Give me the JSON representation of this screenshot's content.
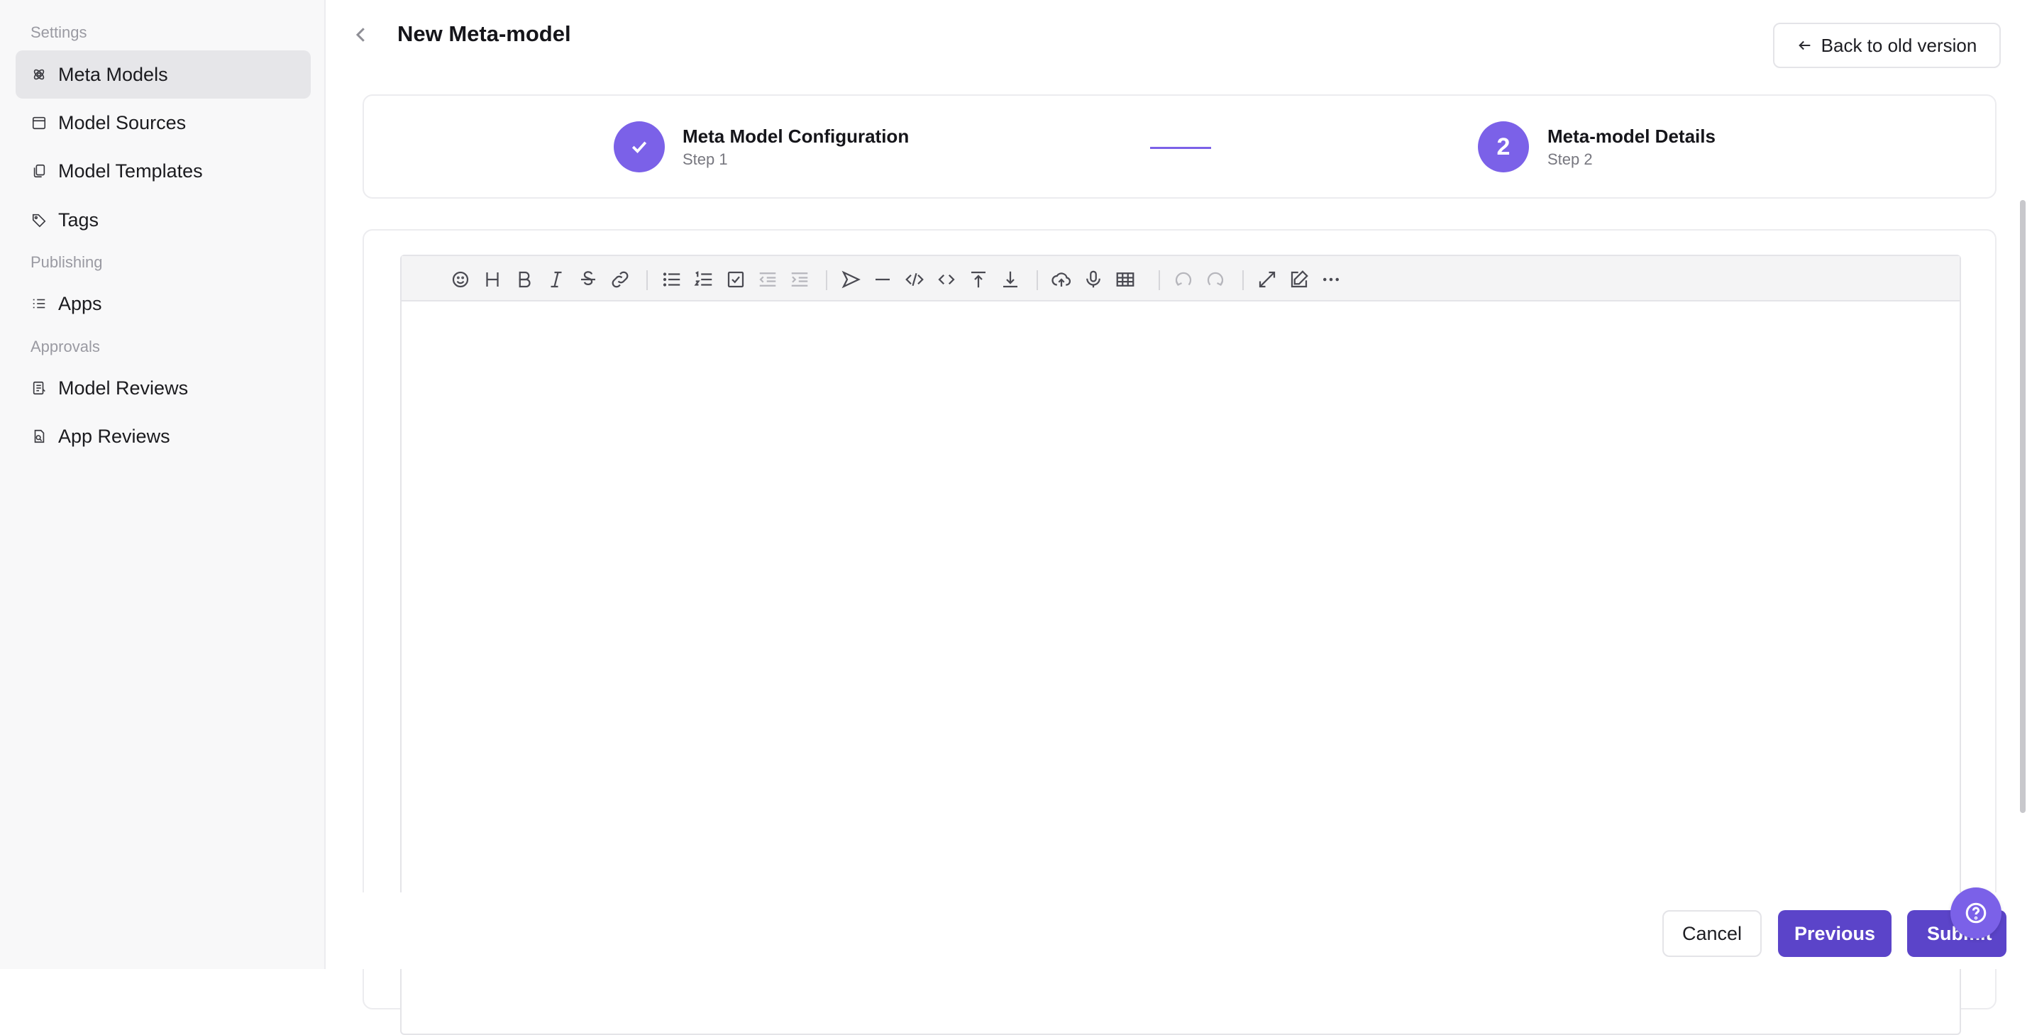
{
  "sidebar": {
    "sections": [
      {
        "label": "Settings"
      },
      {
        "label": "Publishing"
      },
      {
        "label": "Approvals"
      }
    ],
    "items": [
      {
        "label": "Meta Models",
        "icon": "atom-icon",
        "active": true
      },
      {
        "label": "Model Sources",
        "icon": "calendar-icon"
      },
      {
        "label": "Model Templates",
        "icon": "copy-icon"
      },
      {
        "label": "Tags",
        "icon": "tag-icon"
      },
      {
        "label": "Apps",
        "icon": "list-icon"
      },
      {
        "label": "Model Reviews",
        "icon": "document-review-icon"
      },
      {
        "label": "App Reviews",
        "icon": "app-review-icon"
      }
    ]
  },
  "header": {
    "title": "New Meta-model",
    "back_old_version_label": "Back to old version"
  },
  "stepper": {
    "steps": [
      {
        "title": "Meta Model Configuration",
        "subtitle": "Step 1",
        "state": "completed"
      },
      {
        "title": "Meta-model Details",
        "subtitle": "Step 2",
        "number": "2",
        "state": "current"
      }
    ],
    "accent_color": "#7b61e8"
  },
  "editor": {
    "toolbar": [
      "emoji",
      "heading",
      "bold",
      "italic",
      "strikethrough",
      "link",
      "|",
      "bullet-list",
      "ordered-list",
      "check-list",
      "outdent",
      "indent",
      "|",
      "quote",
      "horizontal-rule",
      "code-block",
      "inline-code",
      "insert-before",
      "insert-after",
      "|",
      "upload",
      "record",
      "table",
      "|",
      "undo",
      "redo",
      "|",
      "fullscreen",
      "edit-mode",
      "more"
    ],
    "content": ""
  },
  "footer": {
    "cancel_label": "Cancel",
    "previous_label": "Previous",
    "submit_label": "Submit"
  },
  "colors": {
    "primary_button": "#5b44c9",
    "accent": "#7b61e8"
  }
}
